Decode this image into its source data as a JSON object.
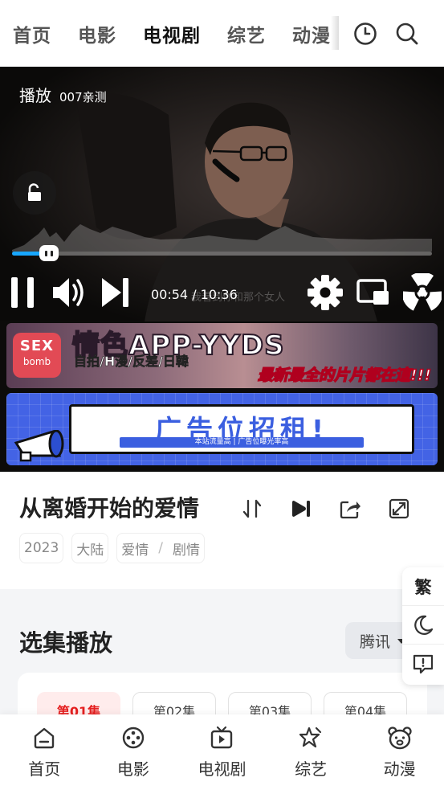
{
  "top_nav": {
    "categories": [
      {
        "label": "首页"
      },
      {
        "label": "电影"
      },
      {
        "label": "电视剧",
        "active": true
      },
      {
        "label": "综艺"
      },
      {
        "label": "动漫"
      }
    ],
    "icons": [
      "history-icon",
      "search-icon"
    ],
    "active_underline_color": "#f6d56a"
  },
  "player": {
    "title_prefix": "播放",
    "title_source": "007亲测",
    "current_time": "00:54",
    "total_time": "10:36",
    "time_display": "00:54 / 10:36",
    "faint_caption": "我看到你和那个女人",
    "progress_fraction": 0.085,
    "progress_color": "#18a7ff"
  },
  "ad_banner_1": {
    "logo_line1": "SEX",
    "logo_line2": "bomb",
    "headline": "情色APP-YYDS",
    "subline": "自拍/H漫/反差/日韓",
    "slogan": "最新最全的片片都在這!!!"
  },
  "ad_banner_2": {
    "headline": "广告位招租!",
    "subline": "本站流量高 | 广告位曝光率高"
  },
  "show": {
    "title": "从离婚开始的爱情",
    "year": "2023",
    "region": "大陆",
    "genre_1": "爱情",
    "genre_sep": "/",
    "genre_2": "剧情"
  },
  "episodes": {
    "heading": "选集播放",
    "source": "腾讯",
    "items": [
      {
        "label": "第01集",
        "active": true
      },
      {
        "label": "第02集"
      },
      {
        "label": "第03集"
      },
      {
        "label": "第04集"
      }
    ],
    "active_color": "#e51f1f"
  },
  "side_tools": {
    "traditional_label": "繁"
  },
  "bottom_nav": {
    "items": [
      {
        "label": "首页",
        "icon": "home-icon"
      },
      {
        "label": "电影",
        "icon": "film-reel-icon"
      },
      {
        "label": "电视剧",
        "icon": "tv-icon"
      },
      {
        "label": "综艺",
        "icon": "star-icon"
      },
      {
        "label": "动漫",
        "icon": "bear-icon"
      }
    ]
  }
}
